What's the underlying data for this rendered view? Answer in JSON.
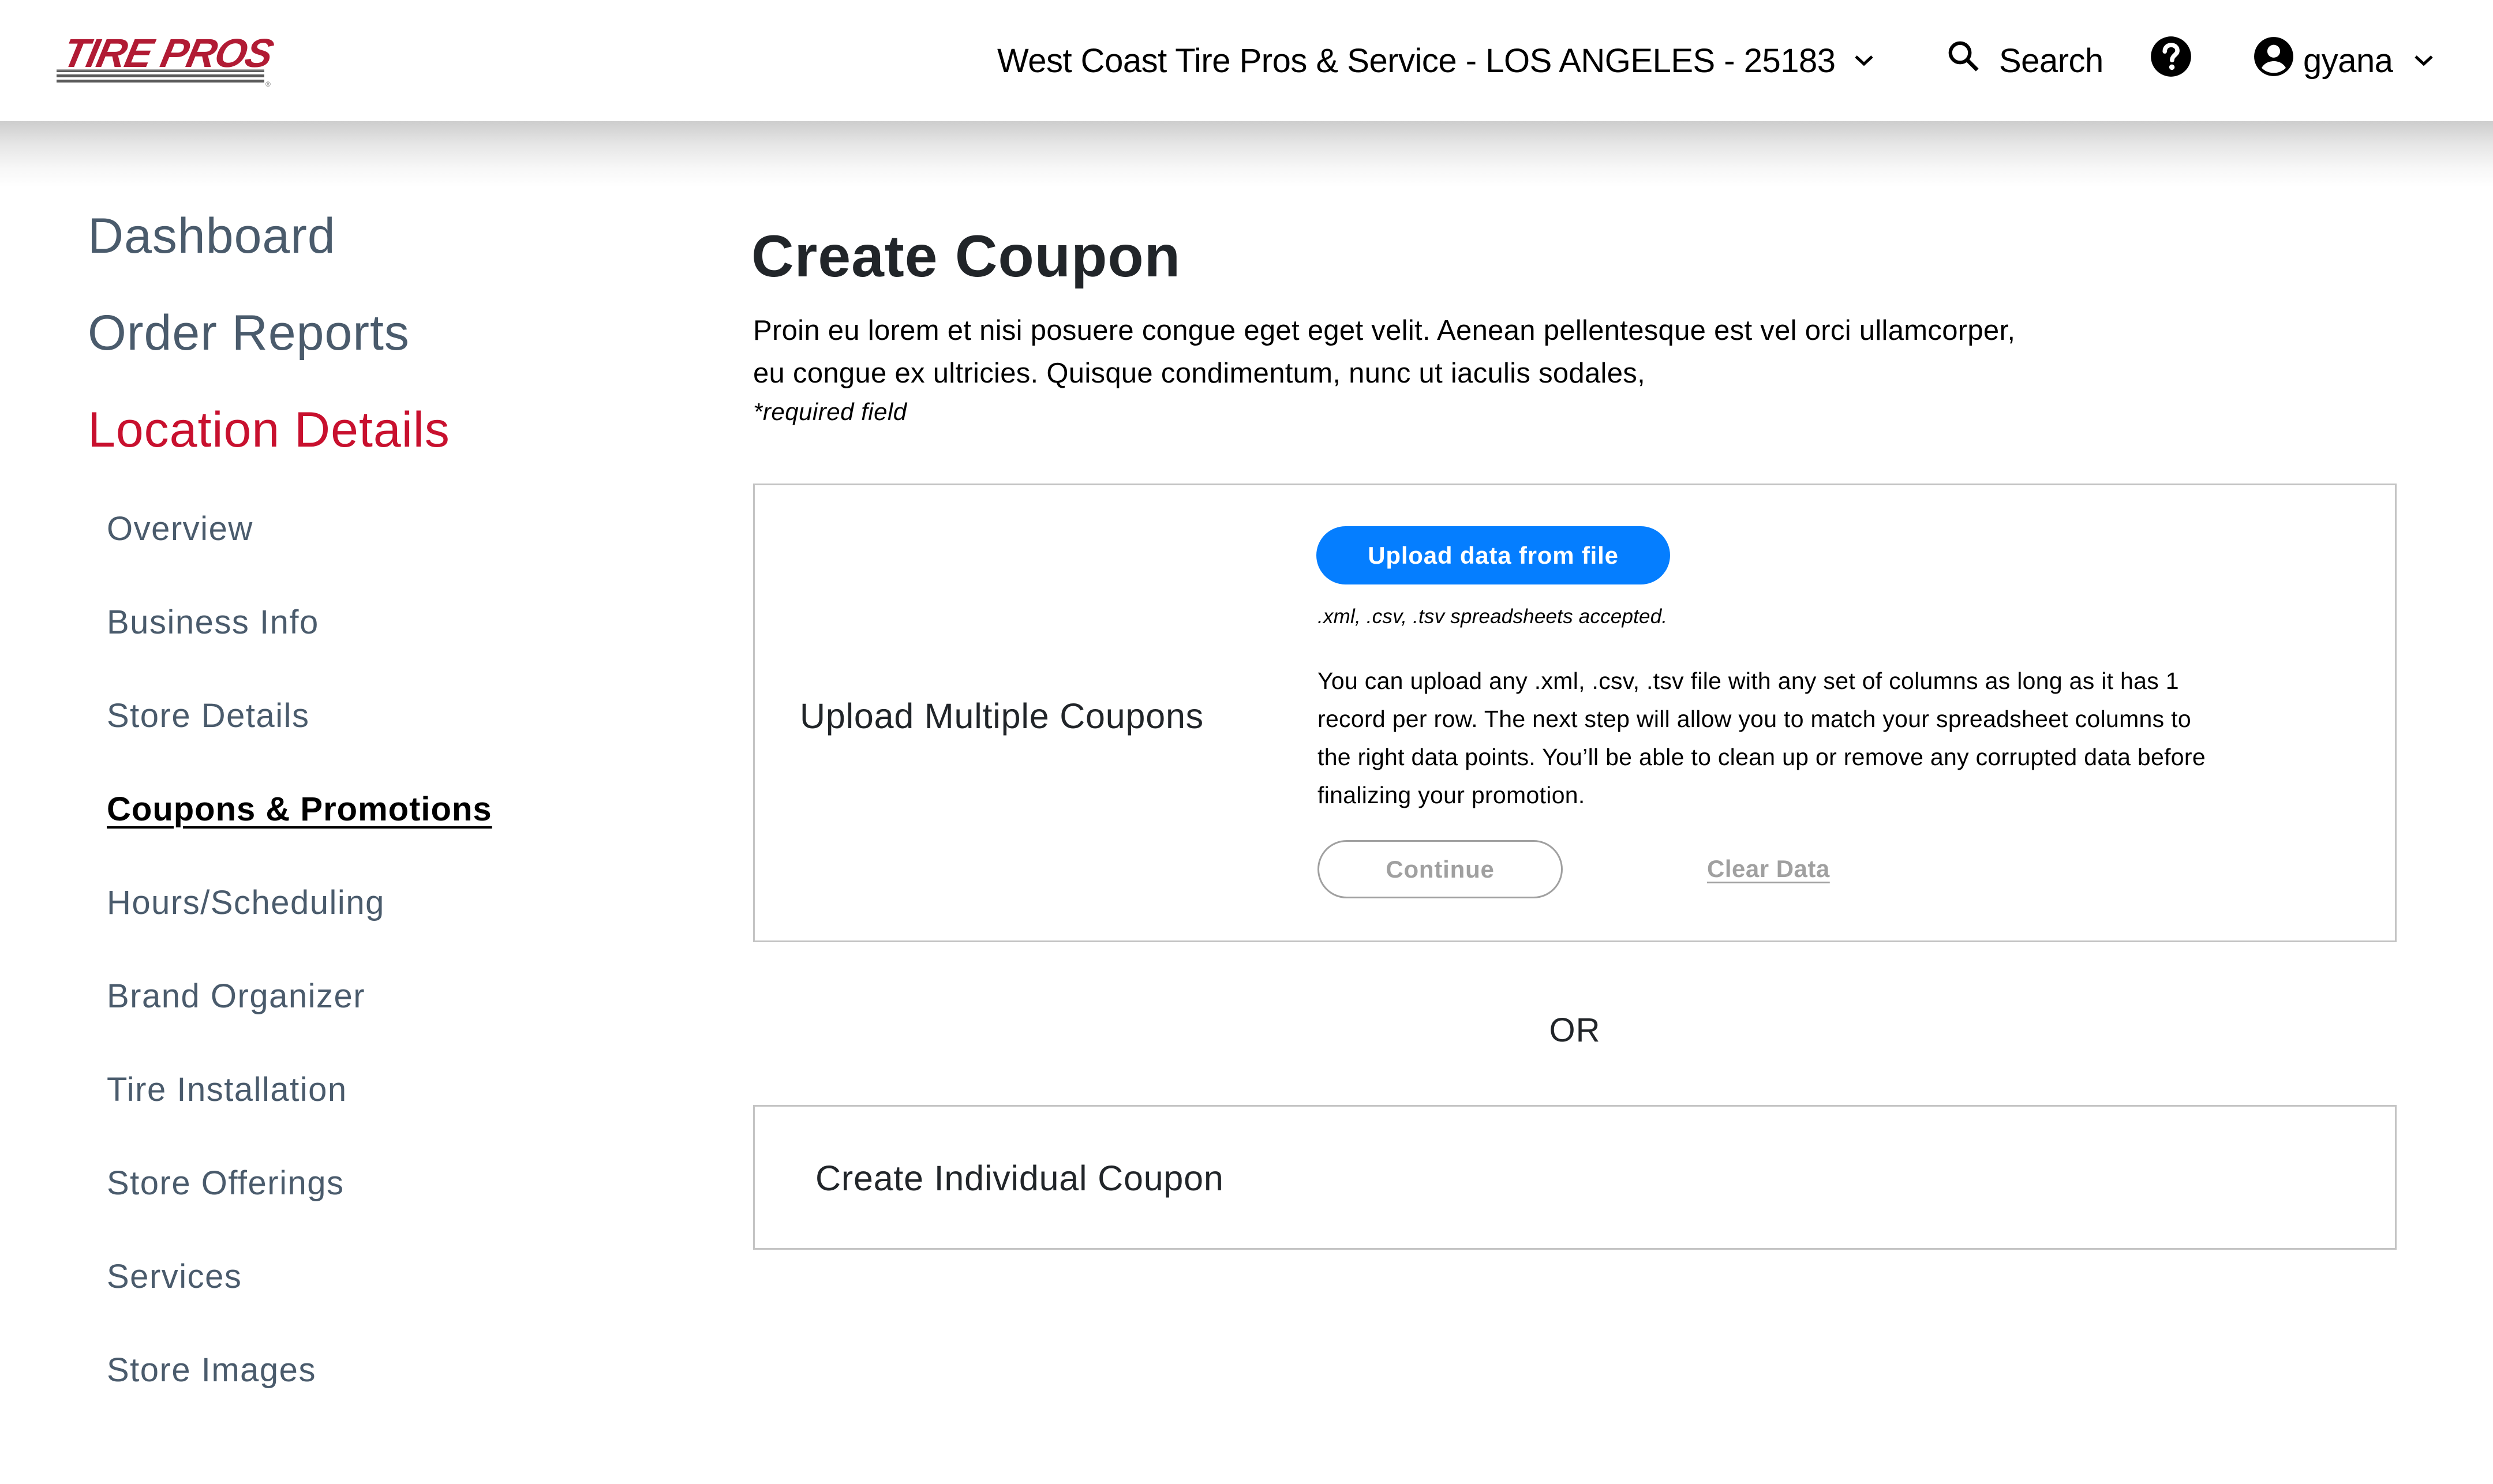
{
  "header": {
    "logo_text": "TIRE PROS",
    "location_selector": "West Coast Tire Pros & Service - LOS ANGELES - 25183",
    "search_label": "Search",
    "user_name": "gyana",
    "icons": {
      "location_chevron": "chevron-down-icon",
      "search": "search-icon",
      "help": "help-circle-icon",
      "user": "account-circle-icon",
      "user_chevron": "chevron-down-icon"
    }
  },
  "sidebar": {
    "main_items": [
      {
        "label": "Dashboard",
        "active": false
      },
      {
        "label": "Order Reports",
        "active": false
      },
      {
        "label": "Location Details",
        "active": true
      }
    ],
    "sub_items": [
      {
        "label": "Overview",
        "active": false
      },
      {
        "label": "Business Info",
        "active": false
      },
      {
        "label": "Store Details",
        "active": false
      },
      {
        "label": "Coupons & Promotions",
        "active": true
      },
      {
        "label": "Hours/Scheduling",
        "active": false
      },
      {
        "label": "Brand Organizer",
        "active": false
      },
      {
        "label": "Tire Installation",
        "active": false
      },
      {
        "label": "Store Offerings",
        "active": false
      },
      {
        "label": "Services",
        "active": false
      },
      {
        "label": "Store Images",
        "active": false
      }
    ]
  },
  "main": {
    "title": "Create Coupon",
    "description": "Proin eu lorem et nisi posuere congue eget eget velit. Aenean pellentesque est vel orci ullamcorper, eu congue ex ultricies. Quisque condimentum, nunc ut iaculis sodales,",
    "required_note": "*required field",
    "upload_card": {
      "label": "Upload Multiple Coupons",
      "upload_button": "Upload data from file",
      "accepted_note": ".xml, .csv, .tsv spreadsheets accepted.",
      "paragraph": "You can upload any .xml, .csv, .tsv file with any set of columns as long as it has 1 record per row. The next step will allow you to match your spreadsheet columns to the right data points. You’ll be able to clean up or remove any corrupted data before finalizing your promotion.",
      "continue_button": "Continue",
      "clear_link": "Clear Data"
    },
    "or_text": "OR",
    "individual_card": {
      "label": "Create Individual Coupon"
    }
  },
  "colors": {
    "brand_red": "#c8102e",
    "nav_gray": "#4a5b6c",
    "primary_blue": "#057eff",
    "disabled_gray": "#a0a0a0",
    "card_border": "#c4c4c4"
  }
}
